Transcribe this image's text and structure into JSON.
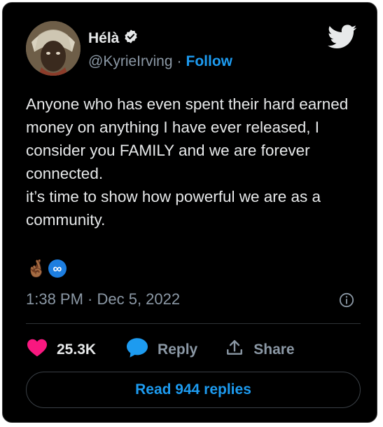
{
  "colors": {
    "background": "#000000",
    "text": "#e7e9ea",
    "muted": "#8b98a5",
    "accent": "#1d9bf0",
    "heart": "#f91880"
  },
  "author": {
    "name": "Hélà",
    "verified_icon": "verified-badge-icon",
    "handle": "@KyrieIrving",
    "separator": "·",
    "follow_label": "Follow"
  },
  "tweet": {
    "text": "Anyone who has even spent their hard earned money on anything I have ever released, I consider you FAMILY and we are forever connected.\nit’s time to show how powerful we are as a community.",
    "emojis": [
      "🤞🏾",
      "♾️"
    ],
    "timestamp": "1:38 PM · Dec 5, 2022"
  },
  "actions": {
    "like_count": "25.3K",
    "reply_label": "Reply",
    "share_label": "Share"
  },
  "footer": {
    "read_replies_label": "Read 944 replies"
  },
  "icons": [
    "twitter-bird-icon",
    "info-icon",
    "heart-icon",
    "reply-bubble-icon",
    "share-icon"
  ]
}
